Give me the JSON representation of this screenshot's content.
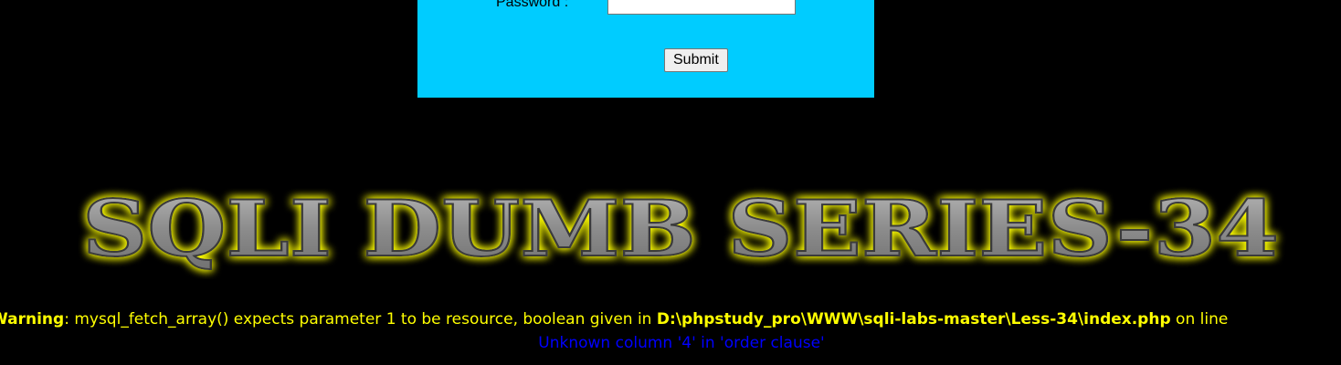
{
  "login_form": {
    "password_label": "Password :",
    "password_value": "",
    "submit_label": "Submit"
  },
  "banner": {
    "title": "SQLI DUMB SERIES-34"
  },
  "messages": {
    "warning_prefix": "Warning",
    "warning_text": ": mysql_fetch_array() expects parameter 1 to be resource, boolean given in ",
    "warning_path": "D:\\phpstudy_pro\\WWW\\sqli-labs-master\\Less-34\\index.php",
    "warning_suffix": " on line",
    "error_text": "Unknown column '4' in 'order clause'"
  },
  "colors": {
    "page_background": "#000000",
    "panel_background": "#00CCFF",
    "warning_text": "#FFFF00",
    "error_text": "#0000FF",
    "title_glow": "#FFFF00",
    "title_fill": "#8A8A8A"
  }
}
